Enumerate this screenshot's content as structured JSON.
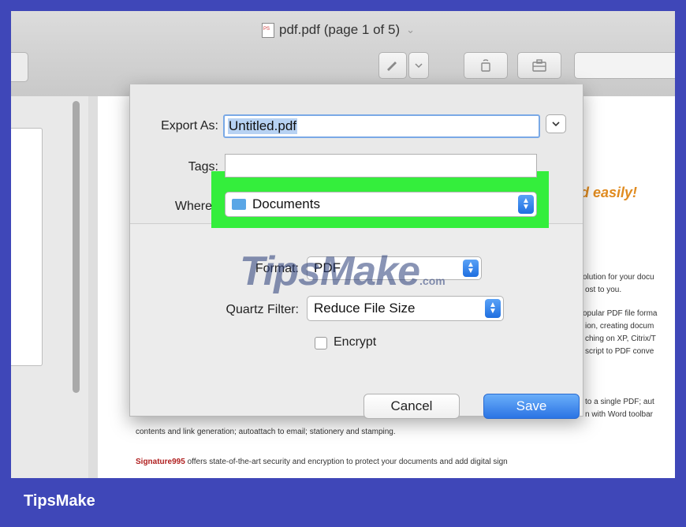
{
  "window": {
    "title": "pdf.pdf (page 1 of 5)",
    "title_chevron": "⌄"
  },
  "toolbar": {
    "markup_icon": "pen-icon",
    "rotate_icon": "rotate-icon",
    "share_icon": "toolbox-icon",
    "search_placeholder": "Q"
  },
  "document": {
    "headline_fragment": "d easily!",
    "lines": [
      "olution for your docu",
      "ost to you.",
      "opular PDF file forma",
      "ion, creating docum",
      "ching on XP, Citrix/T",
      "script to PDF conve",
      "to a single PDF; aut",
      "n with Word toolbar",
      "contents and link generation; autoattach to email; stationery and stamping."
    ],
    "signature_word": "Signature995",
    "signature_rest": " offers state-of-the-art security and encryption to protect your documents and add digital sign"
  },
  "dialog": {
    "export_as_label": "Export As:",
    "export_as_value": "Untitled.pdf",
    "tags_label": "Tags:",
    "tags_value": "",
    "where_label": "Where",
    "where_value": "Documents",
    "format_label": "Format:",
    "format_value": "PDF",
    "quartz_label": "Quartz Filter:",
    "quartz_value": "Reduce File Size",
    "encrypt_label": "Encrypt",
    "cancel_label": "Cancel",
    "save_label": "Save",
    "highlight_color": "#34ee3c"
  },
  "watermark": {
    "main": "TipsMake",
    "suffix": ".com"
  },
  "brand": {
    "label": "TipsMake",
    "border_color": "#3f47b8"
  }
}
